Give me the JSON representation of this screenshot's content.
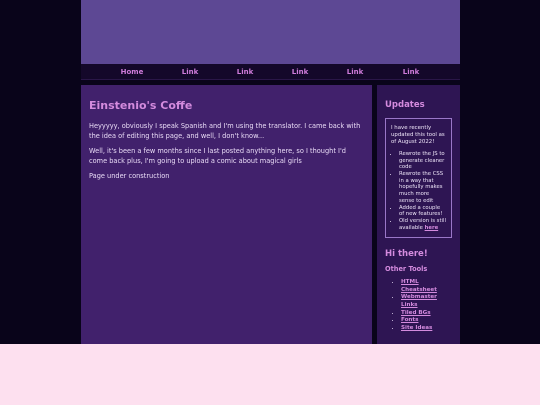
{
  "nav": [
    "Home",
    "Link",
    "Link",
    "Link",
    "Link",
    "Link"
  ],
  "main": {
    "title": "Einstenio's Coffe",
    "paragraphs": [
      "Heyyyyy, obviously I speak Spanish and I'm using the translator. I came back with the idea of editing this page, and well, I don't know...",
      "Well, it's been a few months since I last posted anything here, so I thought I'd come back plus, I'm going to upload a comic about magical girls",
      "Page under construction"
    ]
  },
  "sidebar": {
    "updates_title": "Updates",
    "updates_intro": "I have recently updated this tool as of August 2022!",
    "updates_items": [
      "Rewrote the JS to generate cleaner code",
      "Rewrote the CSS in a way that hopefully makes much more sense to edit",
      "Added a couple of new features!"
    ],
    "old_version_text": "Old version is still available ",
    "old_version_link": "here",
    "hi_title": "Hi there!",
    "tools_title": "Other Tools",
    "tools": [
      "HTML Cheatsheet",
      "Webmaster Links",
      "Tiled BGs",
      "Fonts",
      "Site Ideas"
    ]
  },
  "colors": {
    "background": "#09041a",
    "banner": "#5d4894",
    "main_panel": "#41216c",
    "sidebar_panel": "#2e1553",
    "accent": "#d48bde",
    "footer": "#fde0ef"
  }
}
